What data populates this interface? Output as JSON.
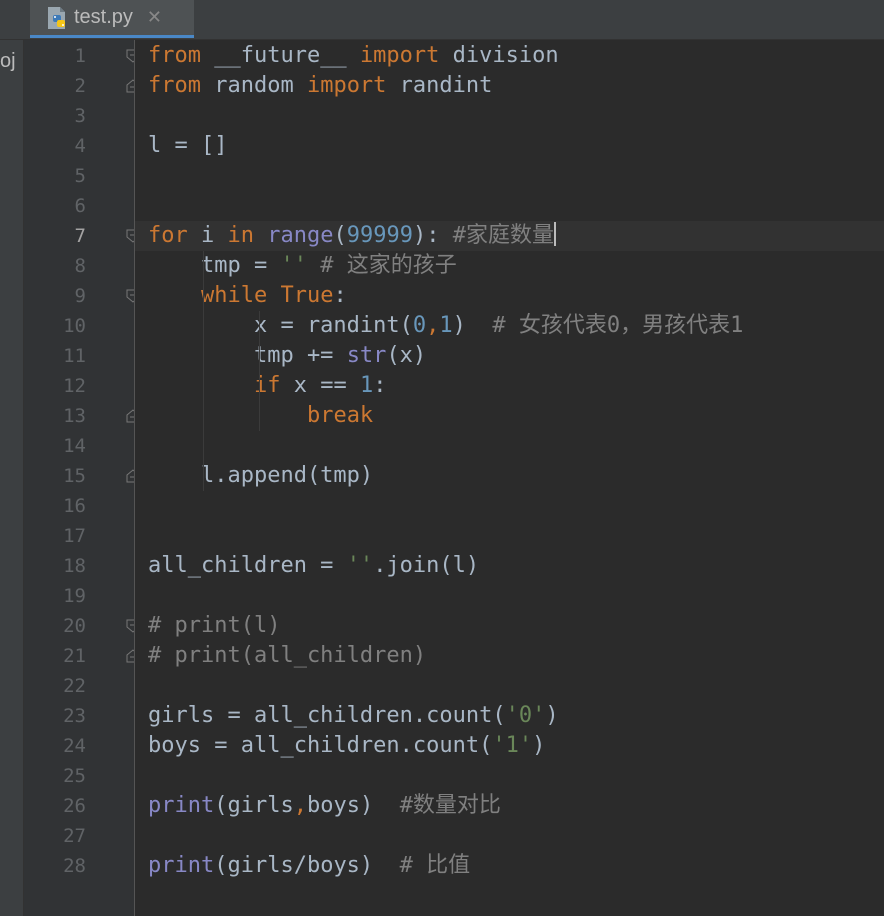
{
  "tab": {
    "file_name": "test.py",
    "close_glyph": "✕",
    "icon": "python-file-icon"
  },
  "project_strip": {
    "dash": "-",
    "label": "oj"
  },
  "editor": {
    "current_line": 7,
    "lines": [
      {
        "n": "1",
        "tokens": [
          [
            "kw",
            "from"
          ],
          [
            "plain",
            " __future__ "
          ],
          [
            "kw",
            "import"
          ],
          [
            "plain",
            " division"
          ]
        ]
      },
      {
        "n": "2",
        "tokens": [
          [
            "kw",
            "from"
          ],
          [
            "plain",
            " random "
          ],
          [
            "kw",
            "import"
          ],
          [
            "plain",
            " randint"
          ]
        ]
      },
      {
        "n": "3",
        "tokens": []
      },
      {
        "n": "4",
        "tokens": [
          [
            "plain",
            "l = []"
          ]
        ]
      },
      {
        "n": "5",
        "tokens": []
      },
      {
        "n": "6",
        "tokens": []
      },
      {
        "n": "7",
        "tokens": [
          [
            "kw",
            "for"
          ],
          [
            "plain",
            " i "
          ],
          [
            "kw",
            "in"
          ],
          [
            "plain",
            " "
          ],
          [
            "builtin",
            "range"
          ],
          [
            "plain",
            "("
          ],
          [
            "num",
            "99999"
          ],
          [
            "plain",
            "): "
          ],
          [
            "cmt",
            "#家庭数量"
          ]
        ]
      },
      {
        "n": "8",
        "tokens": [
          [
            "plain",
            "    tmp = "
          ],
          [
            "str",
            "''"
          ],
          [
            "plain",
            " "
          ],
          [
            "cmt",
            "# 这家的孩子"
          ]
        ]
      },
      {
        "n": "9",
        "tokens": [
          [
            "plain",
            "    "
          ],
          [
            "kw",
            "while"
          ],
          [
            "plain",
            " "
          ],
          [
            "kw",
            "True"
          ],
          [
            "plain",
            ":"
          ]
        ]
      },
      {
        "n": "10",
        "tokens": [
          [
            "plain",
            "        x = randint("
          ],
          [
            "num",
            "0"
          ],
          [
            "kw",
            ","
          ],
          [
            "num",
            "1"
          ],
          [
            "plain",
            ")  "
          ],
          [
            "cmt",
            "# 女孩代表0，男孩代表1"
          ]
        ]
      },
      {
        "n": "11",
        "tokens": [
          [
            "plain",
            "        tmp += "
          ],
          [
            "builtin",
            "str"
          ],
          [
            "plain",
            "(x)"
          ]
        ]
      },
      {
        "n": "12",
        "tokens": [
          [
            "plain",
            "        "
          ],
          [
            "kw",
            "if"
          ],
          [
            "plain",
            " x == "
          ],
          [
            "num",
            "1"
          ],
          [
            "plain",
            ":"
          ]
        ]
      },
      {
        "n": "13",
        "tokens": [
          [
            "plain",
            "            "
          ],
          [
            "kw",
            "break"
          ]
        ]
      },
      {
        "n": "14",
        "tokens": []
      },
      {
        "n": "15",
        "tokens": [
          [
            "plain",
            "    l.append(tmp)"
          ]
        ]
      },
      {
        "n": "16",
        "tokens": []
      },
      {
        "n": "17",
        "tokens": []
      },
      {
        "n": "18",
        "tokens": [
          [
            "plain",
            "all_children = "
          ],
          [
            "str",
            "''"
          ],
          [
            "plain",
            ".join(l)"
          ]
        ]
      },
      {
        "n": "19",
        "tokens": []
      },
      {
        "n": "20",
        "tokens": [
          [
            "cmt",
            "# print(l)"
          ]
        ]
      },
      {
        "n": "21",
        "tokens": [
          [
            "cmt",
            "# print(all_children)"
          ]
        ]
      },
      {
        "n": "22",
        "tokens": []
      },
      {
        "n": "23",
        "tokens": [
          [
            "plain",
            "girls = all_children.count("
          ],
          [
            "str",
            "'0'"
          ],
          [
            "plain",
            ")"
          ]
        ]
      },
      {
        "n": "24",
        "tokens": [
          [
            "plain",
            "boys = all_children.count("
          ],
          [
            "str",
            "'1'"
          ],
          [
            "plain",
            ")"
          ]
        ]
      },
      {
        "n": "25",
        "tokens": []
      },
      {
        "n": "26",
        "tokens": [
          [
            "builtin",
            "print"
          ],
          [
            "plain",
            "(girls"
          ],
          [
            "kw",
            ","
          ],
          [
            "plain",
            "boys)  "
          ],
          [
            "cmt",
            "#数量对比"
          ]
        ]
      },
      {
        "n": "27",
        "tokens": []
      },
      {
        "n": "28",
        "tokens": [
          [
            "builtin",
            "print"
          ],
          [
            "plain",
            "(girls/boys)  "
          ],
          [
            "cmt",
            "# 比值"
          ]
        ]
      }
    ],
    "fold_open_lines": [
      1,
      7,
      9,
      20
    ],
    "fold_close_lines": [
      2,
      13,
      15,
      21
    ]
  },
  "colors": {
    "keyword": "#cc7832",
    "builtin": "#8888c6",
    "number": "#6897bb",
    "string": "#6a8759",
    "comment": "#808080",
    "text": "#a9b7c6",
    "background": "#2b2b2b"
  }
}
